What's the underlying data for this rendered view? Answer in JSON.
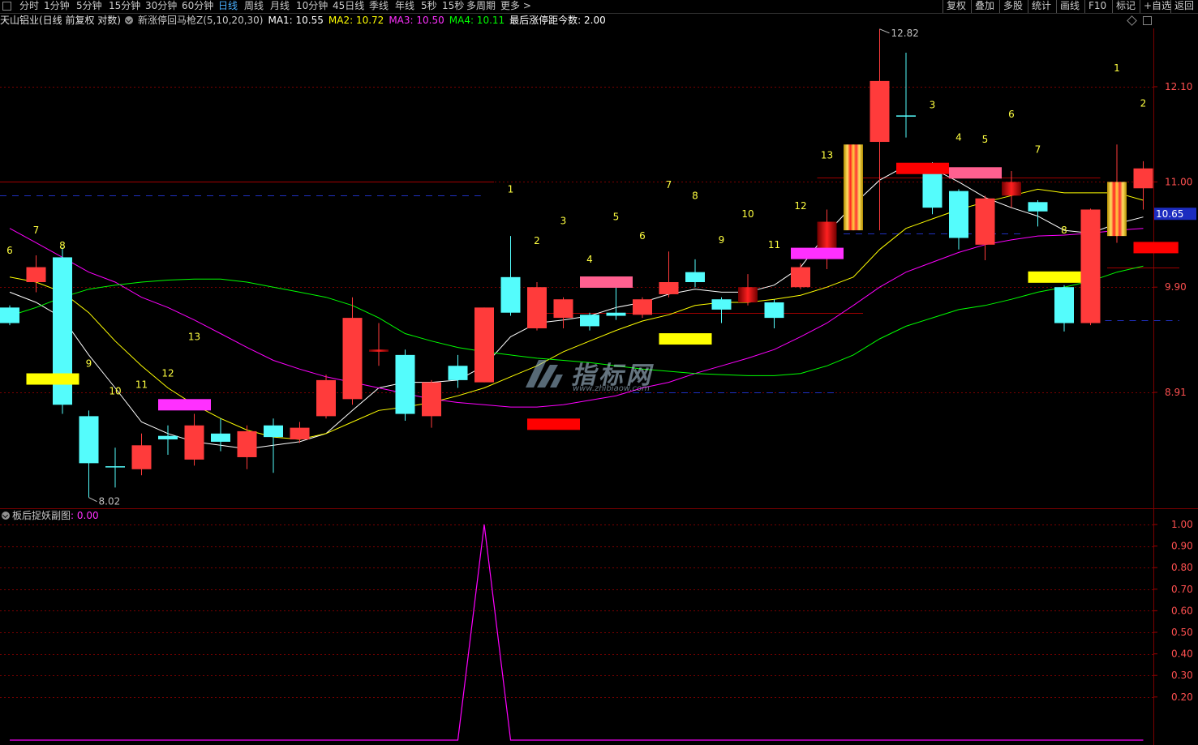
{
  "toolbar": {
    "periods": [
      "分时",
      "1分钟",
      "5分钟",
      "15分钟",
      "30分钟",
      "60分钟",
      "日线",
      "周线",
      "月线",
      "10分钟",
      "45日线",
      "季线",
      "年线",
      "5秒",
      "15秒",
      "多周期",
      "更多 >"
    ],
    "active_period": "日线",
    "right_buttons": [
      "复权",
      "叠加",
      "多股",
      "统计",
      "画线",
      "F10",
      "标记",
      "+自选",
      "返回"
    ]
  },
  "main_info": {
    "stock": "天山铝业(日线 前复权 对数)",
    "indicator": "新涨停回马枪Z(5,10,20,30)",
    "ma1": "MA1: 10.55",
    "ma2": "MA2: 10.72",
    "ma3": "MA3: 10.50",
    "ma4": "MA4: 10.11",
    "last_limit": "最后涨停距今数: 2.00"
  },
  "colors": {
    "ma1": "#ffffff",
    "ma2": "#ffff00",
    "ma3": "#ff00ff",
    "ma4": "#00ff00",
    "up": "#ff3b3b",
    "down": "#54fcfc",
    "grid": "#7a0000",
    "axis_text": "#ff5050",
    "price_tag_bg": "#1c2cc0",
    "sub_line": "#ff00ff"
  },
  "sub_info": {
    "name": "板后捉妖副图",
    "value": ": 0.00"
  },
  "price_axis": {
    "ticks": [
      {
        "label": "12.10",
        "value": 12.1
      },
      {
        "label": "11.00",
        "value": 11.0
      },
      {
        "label": "9.90",
        "value": 9.9
      },
      {
        "label": "8.91",
        "value": 8.91
      }
    ],
    "current": {
      "label": "10.65",
      "value": 10.65
    }
  },
  "sub_axis": {
    "ticks": [
      {
        "label": "1.00",
        "value": 1.0
      },
      {
        "label": "0.90",
        "value": 0.9
      },
      {
        "label": "0.80",
        "value": 0.8
      },
      {
        "label": "0.70",
        "value": 0.7
      },
      {
        "label": "0.60",
        "value": 0.6
      },
      {
        "label": "0.50",
        "value": 0.5
      },
      {
        "label": "0.40",
        "value": 0.4
      },
      {
        "label": "0.30",
        "value": 0.3
      },
      {
        "label": "0.20",
        "value": 0.2
      }
    ]
  },
  "watermark": {
    "text": "指标网",
    "url": "www.zhibiaow.com"
  },
  "chart_data": {
    "type": "candlestick",
    "scale": "log",
    "high_label": "12.82",
    "low_label": "8.02",
    "candles": [
      {
        "o": 9.7,
        "c": 9.55,
        "h": 9.72,
        "l": 9.53
      },
      {
        "o": 9.95,
        "c": 10.1,
        "h": 10.22,
        "l": 9.85
      },
      {
        "o": 10.2,
        "c": 8.8,
        "h": 10.3,
        "l": 8.72
      },
      {
        "o": 8.7,
        "c": 8.3,
        "h": 8.75,
        "l": 8.02
      },
      {
        "o": 8.27,
        "c": 8.27,
        "h": 8.43,
        "l": 8.1
      },
      {
        "o": 8.25,
        "c": 8.45,
        "h": 8.55,
        "l": 8.2
      },
      {
        "o": 8.53,
        "c": 8.5,
        "h": 8.62,
        "l": 8.37
      },
      {
        "o": 8.33,
        "c": 8.62,
        "h": 8.72,
        "l": 8.28
      },
      {
        "o": 8.55,
        "c": 8.48,
        "h": 8.68,
        "l": 8.4
      },
      {
        "o": 8.35,
        "c": 8.57,
        "h": 8.62,
        "l": 8.25
      },
      {
        "o": 8.62,
        "c": 8.52,
        "h": 8.68,
        "l": 8.22
      },
      {
        "o": 8.5,
        "c": 8.6,
        "h": 8.65,
        "l": 8.47
      },
      {
        "o": 8.7,
        "c": 9.02,
        "h": 9.07,
        "l": 8.68
      },
      {
        "o": 8.85,
        "c": 9.6,
        "h": 9.8,
        "l": 8.8
      },
      {
        "o": 9.28,
        "c": 9.3,
        "h": 9.55,
        "l": 9.15
      },
      {
        "o": 9.25,
        "c": 8.72,
        "h": 9.3,
        "l": 8.66
      },
      {
        "o": 8.7,
        "c": 9.0,
        "h": 9.02,
        "l": 8.6
      },
      {
        "o": 9.15,
        "c": 9.02,
        "h": 9.25,
        "l": 8.95
      },
      {
        "o": 9.0,
        "c": 9.7,
        "h": 9.7,
        "l": 9.0
      },
      {
        "o": 10.0,
        "c": 9.65,
        "h": 10.42,
        "l": 9.62
      },
      {
        "o": 9.5,
        "c": 9.9,
        "h": 9.95,
        "l": 9.48
      },
      {
        "o": 9.6,
        "c": 9.78,
        "h": 9.8,
        "l": 9.5
      },
      {
        "o": 9.63,
        "c": 9.52,
        "h": 9.65,
        "l": 9.48
      },
      {
        "o": 9.65,
        "c": 9.62,
        "h": 10.0,
        "l": 9.58
      },
      {
        "o": 9.63,
        "c": 9.78,
        "h": 9.8,
        "l": 9.6
      },
      {
        "o": 9.83,
        "c": 9.95,
        "h": 10.26,
        "l": 9.8
      },
      {
        "o": 10.05,
        "c": 9.95,
        "h": 10.18,
        "l": 9.9
      },
      {
        "o": 9.78,
        "c": 9.68,
        "h": 9.8,
        "l": 9.55
      },
      {
        "o": 9.75,
        "c": 9.9,
        "h": 10.03,
        "l": 9.72
      },
      {
        "o": 9.75,
        "c": 9.6,
        "h": 9.78,
        "l": 9.5
      },
      {
        "o": 9.9,
        "c": 10.1,
        "h": 10.14,
        "l": 9.88
      },
      {
        "o": 10.28,
        "c": 10.57,
        "h": 10.7,
        "l": 10.08
      },
      {
        "o": 10.48,
        "c": 11.42,
        "h": 11.42,
        "l": 10.48
      },
      {
        "o": 11.45,
        "c": 12.17,
        "h": 12.82,
        "l": 10.48
      },
      {
        "o": 11.75,
        "c": 11.75,
        "h": 12.52,
        "l": 11.5
      },
      {
        "o": 11.15,
        "c": 10.72,
        "h": 11.22,
        "l": 10.65
      },
      {
        "o": 10.9,
        "c": 10.4,
        "h": 10.92,
        "l": 10.28
      },
      {
        "o": 10.33,
        "c": 10.82,
        "h": 10.85,
        "l": 10.17
      },
      {
        "o": 10.85,
        "c": 11.0,
        "h": 11.12,
        "l": 10.72
      },
      {
        "o": 10.78,
        "c": 10.68,
        "h": 10.8,
        "l": 10.52
      },
      {
        "o": 9.9,
        "c": 9.55,
        "h": 9.92,
        "l": 9.47
      },
      {
        "o": 9.55,
        "c": 10.7,
        "h": 10.71,
        "l": 9.53
      },
      {
        "o": 10.42,
        "c": 11.0,
        "h": 11.42,
        "l": 10.35
      },
      {
        "o": 10.93,
        "c": 11.15,
        "h": 11.23,
        "l": 10.7
      }
    ],
    "ma1": [
      9.85,
      9.75,
      9.6,
      9.25,
      8.95,
      8.65,
      8.55,
      8.48,
      8.45,
      8.42,
      8.45,
      8.48,
      8.55,
      8.75,
      8.95,
      9.0,
      9.0,
      9.02,
      9.15,
      9.42,
      9.55,
      9.58,
      9.62,
      9.7,
      9.75,
      9.83,
      9.88,
      9.85,
      9.85,
      9.92,
      10.1,
      10.45,
      10.75,
      11.02,
      11.18,
      11.15,
      11.0,
      10.83,
      10.72,
      10.63,
      10.48,
      10.45,
      10.55,
      10.62
    ],
    "ma2": [
      10.0,
      9.95,
      9.85,
      9.65,
      9.38,
      9.15,
      8.95,
      8.8,
      8.68,
      8.58,
      8.52,
      8.5,
      8.55,
      8.65,
      8.75,
      8.78,
      8.82,
      8.88,
      8.95,
      9.05,
      9.15,
      9.28,
      9.38,
      9.48,
      9.57,
      9.63,
      9.72,
      9.75,
      9.75,
      9.78,
      9.82,
      9.9,
      10.0,
      10.28,
      10.5,
      10.6,
      10.7,
      10.78,
      10.85,
      10.92,
      10.88,
      10.88,
      10.88,
      10.8
    ],
    "ma3": [
      10.5,
      10.35,
      10.2,
      10.05,
      9.95,
      9.8,
      9.7,
      9.58,
      9.45,
      9.32,
      9.2,
      9.12,
      9.05,
      9.0,
      8.95,
      8.9,
      8.85,
      8.82,
      8.8,
      8.78,
      8.78,
      8.8,
      8.84,
      8.88,
      8.95,
      9.0,
      9.08,
      9.15,
      9.22,
      9.3,
      9.42,
      9.55,
      9.72,
      9.9,
      10.05,
      10.15,
      10.25,
      10.33,
      10.38,
      10.42,
      10.43,
      10.45,
      10.48,
      10.5
    ],
    "ma4": [
      9.62,
      9.7,
      9.8,
      9.88,
      9.92,
      9.95,
      9.97,
      9.98,
      9.98,
      9.95,
      9.9,
      9.85,
      9.8,
      9.72,
      9.6,
      9.45,
      9.38,
      9.32,
      9.28,
      9.25,
      9.22,
      9.2,
      9.18,
      9.15,
      9.12,
      9.1,
      9.08,
      9.07,
      9.06,
      9.06,
      9.08,
      9.15,
      9.25,
      9.4,
      9.52,
      9.6,
      9.68,
      9.72,
      9.78,
      9.85,
      9.9,
      9.96,
      10.05,
      10.11
    ],
    "bars": [
      {
        "i": 1,
        "v": 9.03,
        "w": 2,
        "color": "#ffff00"
      },
      {
        "i": 6,
        "v": 8.8,
        "w": 2,
        "color": "#ff30ff"
      },
      {
        "i": 20,
        "v": 8.63,
        "w": 2,
        "color": "#ff0000"
      },
      {
        "i": 22,
        "v": 9.95,
        "w": 2,
        "color": "#ff6090"
      },
      {
        "i": 25,
        "v": 9.4,
        "w": 2,
        "color": "#ffff00"
      },
      {
        "i": 30,
        "v": 10.24,
        "w": 2,
        "color": "#ff30ff"
      },
      {
        "i": 34,
        "v": 11.15,
        "w": 2,
        "color": "#ff0000"
      },
      {
        "i": 36,
        "v": 11.1,
        "w": 2,
        "color": "#ff6090"
      },
      {
        "i": 39,
        "v": 10.0,
        "w": 2,
        "color": "#ffff00"
      },
      {
        "i": 43,
        "v": 10.3,
        "w": 1.7,
        "color": "#ff0000"
      }
    ],
    "limit_candles": [
      14,
      28,
      31,
      32,
      38,
      42
    ],
    "levels": [
      {
        "price": 11.0,
        "from": 0,
        "to": 18,
        "color": "#a00000",
        "dashed": false
      },
      {
        "price": 10.85,
        "from": 0,
        "to": 17.5,
        "color": "#2030c0",
        "dashed": true
      },
      {
        "price": 9.65,
        "from": 20,
        "to": 32,
        "color": "#a00000",
        "dashed": false
      },
      {
        "price": 8.91,
        "from": 24,
        "to": 31,
        "color": "#2030c0",
        "dashed": true
      },
      {
        "price": 11.05,
        "from": 31,
        "to": 41,
        "color": "#a00000",
        "dashed": false
      },
      {
        "price": 10.45,
        "from": 32,
        "to": 38,
        "color": "#2030c0",
        "dashed": true
      },
      {
        "price": 10.1,
        "from": 42,
        "to": 44,
        "color": "#a00000",
        "dashed": false
      },
      {
        "price": 9.58,
        "from": 41,
        "to": 44,
        "color": "#2030c0",
        "dashed": true
      }
    ],
    "counts": [
      {
        "i": 0,
        "t": "6",
        "v": 10.27
      },
      {
        "i": 1,
        "t": "7",
        "v": 10.48
      },
      {
        "i": 2,
        "t": "8",
        "v": 10.32
      },
      {
        "i": 3,
        "t": "9",
        "v": 9.17
      },
      {
        "i": 4,
        "t": "10",
        "v": 8.92
      },
      {
        "i": 5,
        "t": "11",
        "v": 8.98
      },
      {
        "i": 6,
        "t": "12",
        "v": 9.08
      },
      {
        "i": 7,
        "t": "13",
        "v": 9.42
      },
      {
        "i": 19,
        "t": "1",
        "v": 10.92
      },
      {
        "i": 20,
        "t": "2",
        "v": 10.37
      },
      {
        "i": 21,
        "t": "3",
        "v": 10.58
      },
      {
        "i": 22,
        "t": "4",
        "v": 10.18
      },
      {
        "i": 23,
        "t": "5",
        "v": 10.62
      },
      {
        "i": 24,
        "t": "6",
        "v": 10.42
      },
      {
        "i": 25,
        "t": "7",
        "v": 10.97
      },
      {
        "i": 26,
        "t": "8",
        "v": 10.85
      },
      {
        "i": 27,
        "t": "9",
        "v": 10.38
      },
      {
        "i": 28,
        "t": "10",
        "v": 10.65
      },
      {
        "i": 29,
        "t": "11",
        "v": 10.33
      },
      {
        "i": 30,
        "t": "12",
        "v": 10.74
      },
      {
        "i": 31,
        "t": "13",
        "v": 11.3
      },
      {
        "i": 35,
        "t": "3",
        "v": 11.88
      },
      {
        "i": 36,
        "t": "4",
        "v": 11.5
      },
      {
        "i": 37,
        "t": "5",
        "v": 11.48
      },
      {
        "i": 38,
        "t": "6",
        "v": 11.77
      },
      {
        "i": 39,
        "t": "7",
        "v": 11.36
      },
      {
        "i": 40,
        "t": "8",
        "v": 10.48
      },
      {
        "i": 42,
        "t": "1",
        "v": 12.33
      },
      {
        "i": 43,
        "t": "2",
        "v": 11.9
      }
    ],
    "sub_series": [
      0,
      0,
      0,
      0,
      0,
      0,
      0,
      0,
      0,
      0,
      0,
      0,
      0,
      0,
      0,
      0,
      0,
      0,
      1,
      0,
      0,
      0,
      0,
      0,
      0,
      0,
      0,
      0,
      0,
      0,
      0,
      0,
      0,
      0,
      0,
      0,
      0,
      0,
      0,
      0,
      0,
      0,
      0,
      0
    ]
  }
}
